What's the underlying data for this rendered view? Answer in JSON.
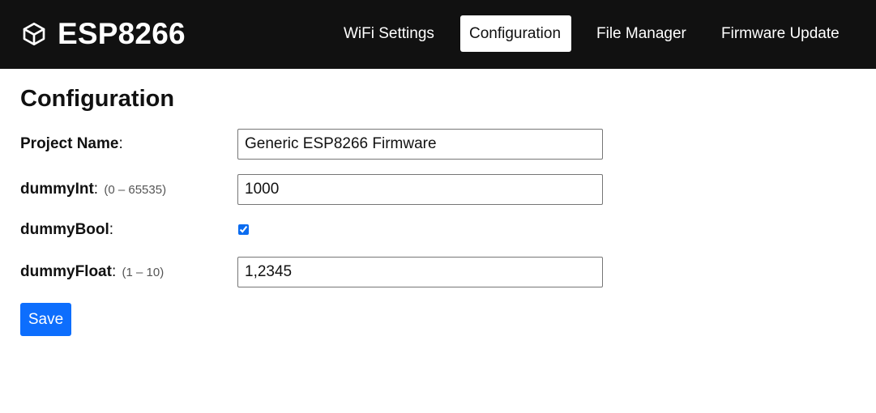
{
  "header": {
    "brand_icon": "cube-icon",
    "brand_title": "ESP8266",
    "nav": [
      {
        "label": "WiFi Settings",
        "active": false
      },
      {
        "label": "Configuration",
        "active": true
      },
      {
        "label": "File Manager",
        "active": false
      },
      {
        "label": "Firmware Update",
        "active": false
      }
    ]
  },
  "main": {
    "title": "Configuration",
    "fields": {
      "project_name": {
        "label": "Project Name",
        "range": "",
        "value": "Generic ESP8266 Firmware"
      },
      "dummy_int": {
        "label": "dummyInt",
        "range": "(0 – 65535)",
        "value": "1000"
      },
      "dummy_bool": {
        "label": "dummyBool",
        "range": "",
        "checked": true
      },
      "dummy_float": {
        "label": "dummyFloat",
        "range": "(1 – 10)",
        "value": "1,2345"
      }
    },
    "save_label": "Save"
  },
  "colors": {
    "navbar_bg": "#111111",
    "accent": "#0d6efd"
  }
}
